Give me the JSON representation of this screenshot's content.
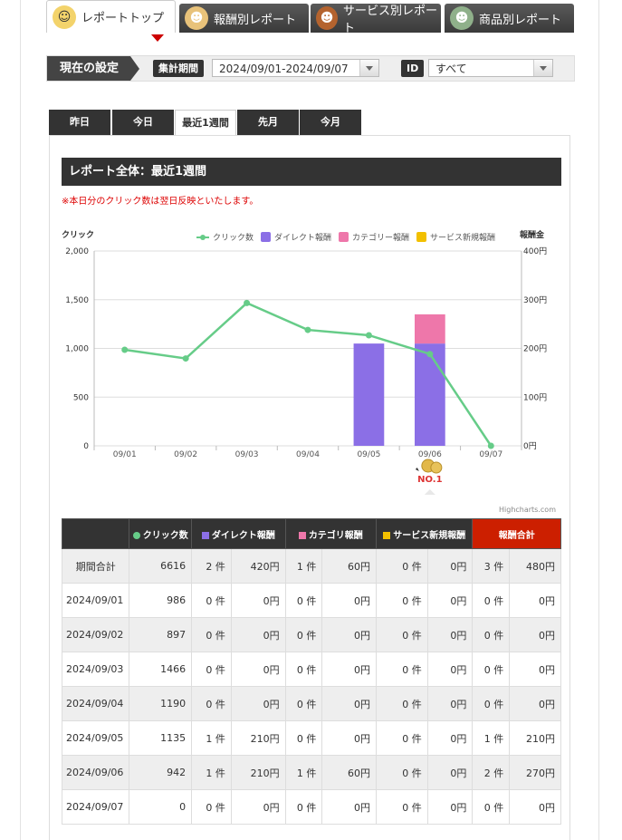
{
  "top_tabs": [
    {
      "label": "レポートトップ",
      "icon": "samurai-icon",
      "active": true
    },
    {
      "label": "報酬別レポート",
      "icon": "monkey-icon",
      "active": false
    },
    {
      "label": "サービス別レポート",
      "icon": "bear-icon",
      "active": false
    },
    {
      "label": "商品別レポート",
      "icon": "frog-icon",
      "active": false
    }
  ],
  "settings": {
    "title": "現在の設定",
    "period_label": "集計期間",
    "period_value": "2024/09/01-2024/09/07",
    "id_label": "ID",
    "id_value": "すべて"
  },
  "period_tabs": [
    {
      "label": "昨日",
      "active": false
    },
    {
      "label": "今日",
      "active": false
    },
    {
      "label": "最近1週間",
      "active": true
    },
    {
      "label": "先月",
      "active": false
    },
    {
      "label": "今月",
      "active": false
    }
  ],
  "section_title": "レポート全体：最近1週間",
  "note": "※本日分のクリック数は翌日反映といたします。",
  "badge": "NO.1",
  "credit": "Highcharts.com",
  "chart_data": {
    "type": "bar",
    "categories": [
      "09/01",
      "09/02",
      "09/03",
      "09/04",
      "09/05",
      "09/06",
      "09/07"
    ],
    "y_left_label": "クリック",
    "y_right_label": "報酬金",
    "y_left_ticks": [
      "0",
      "500",
      "1,000",
      "1,500",
      "2,000"
    ],
    "y_right_ticks": [
      "0円",
      "100円",
      "200円",
      "300円",
      "400円"
    ],
    "ylim_left": [
      0,
      2000
    ],
    "ylim_right": [
      0,
      400
    ],
    "legend": [
      "クリック数",
      "ダイレクト報酬",
      "カテゴリー報酬",
      "サービス新規報酬"
    ],
    "colors": {
      "clicks": "#66cc88",
      "direct": "#8b6fe6",
      "category": "#ee77aa",
      "service": "#f2c000"
    },
    "series": [
      {
        "name": "クリック数",
        "type": "line",
        "values": [
          986,
          897,
          1466,
          1190,
          1135,
          942,
          0
        ]
      },
      {
        "name": "ダイレクト報酬",
        "type": "bar",
        "values": [
          0,
          0,
          0,
          0,
          210,
          210,
          0
        ]
      },
      {
        "name": "カテゴリー報酬",
        "type": "bar",
        "values": [
          0,
          0,
          0,
          0,
          0,
          60,
          0
        ]
      },
      {
        "name": "サービス新規報酬",
        "type": "bar",
        "values": [
          0,
          0,
          0,
          0,
          0,
          0,
          0
        ]
      }
    ]
  },
  "table": {
    "headers": [
      "クリック数",
      "ダイレクト報酬",
      "カテゴリ報酬",
      "サービス新規報酬",
      "報酬合計"
    ],
    "rows": [
      [
        "期間合計",
        "6616",
        "2 件",
        "420円",
        "1 件",
        "60円",
        "0 件",
        "0円",
        "3 件",
        "480円"
      ],
      [
        "2024/09/01",
        "986",
        "0 件",
        "0円",
        "0 件",
        "0円",
        "0 件",
        "0円",
        "0 件",
        "0円"
      ],
      [
        "2024/09/02",
        "897",
        "0 件",
        "0円",
        "0 件",
        "0円",
        "0 件",
        "0円",
        "0 件",
        "0円"
      ],
      [
        "2024/09/03",
        "1466",
        "0 件",
        "0円",
        "0 件",
        "0円",
        "0 件",
        "0円",
        "0 件",
        "0円"
      ],
      [
        "2024/09/04",
        "1190",
        "0 件",
        "0円",
        "0 件",
        "0円",
        "0 件",
        "0円",
        "0 件",
        "0円"
      ],
      [
        "2024/09/05",
        "1135",
        "1 件",
        "210円",
        "0 件",
        "0円",
        "0 件",
        "0円",
        "1 件",
        "210円"
      ],
      [
        "2024/09/06",
        "942",
        "1 件",
        "210円",
        "1 件",
        "60円",
        "0 件",
        "0円",
        "2 件",
        "270円"
      ],
      [
        "2024/09/07",
        "0",
        "0 件",
        "0円",
        "0 件",
        "0円",
        "0 件",
        "0円",
        "0 件",
        "0円"
      ]
    ]
  }
}
